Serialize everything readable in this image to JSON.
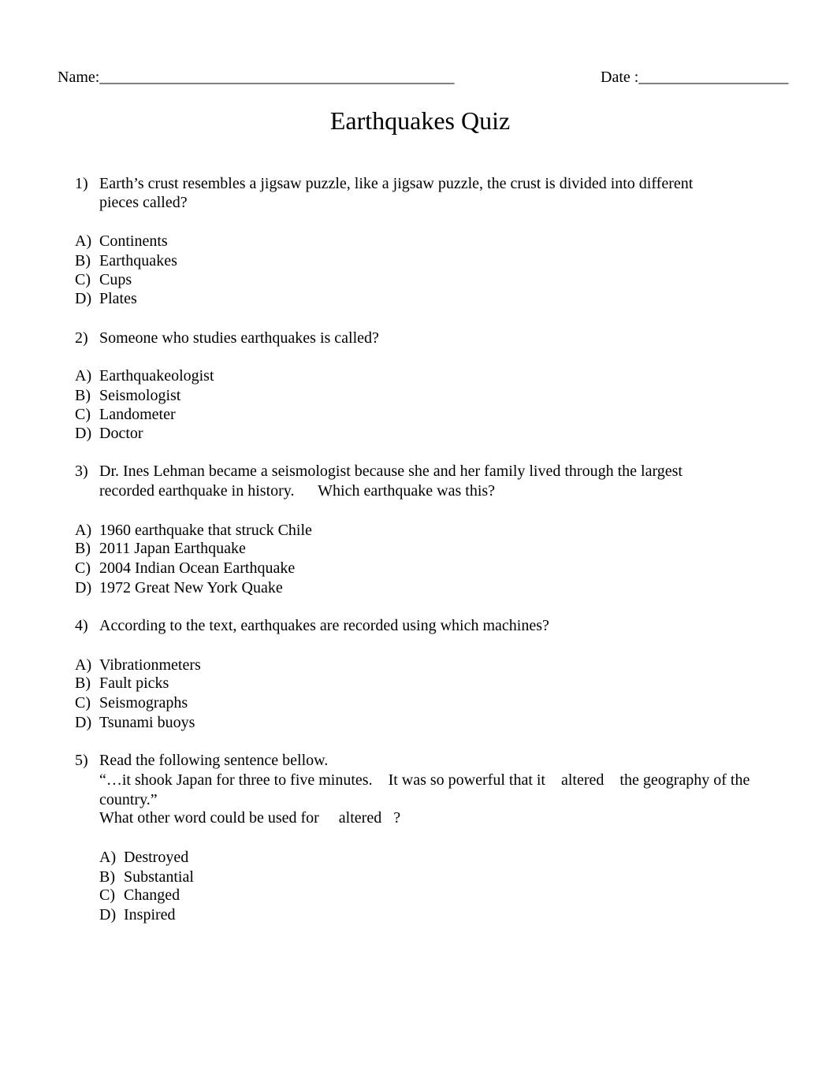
{
  "header": {
    "name_label": "Name:",
    "name_blank": "_____________________________________________",
    "date_label": "Date :",
    "date_blank": "___________________"
  },
  "title": "Earthquakes Quiz",
  "questions": [
    {
      "number": "1)",
      "lines": [
        "Earth’s crust resembles a jigsaw puzzle, like a jigsaw puzzle, the crust is divided into different",
        "pieces called?"
      ],
      "options": [
        {
          "label": "A)",
          "text": "Continents"
        },
        {
          "label": "B)",
          "text": "Earthquakes"
        },
        {
          "label": "C)",
          "text": "Cups"
        },
        {
          "label": "D)",
          "text": "Plates"
        }
      ]
    },
    {
      "number": "2)",
      "lines": [
        "Someone who studies earthquakes is called?"
      ],
      "options": [
        {
          "label": "A)",
          "text": "Earthquakeologist"
        },
        {
          "label": "B)",
          "text": "Seismologist"
        },
        {
          "label": "C)",
          "text": "Landometer"
        },
        {
          "label": "D)",
          "text": "Doctor"
        }
      ]
    },
    {
      "number": "3)",
      "lines": [
        "Dr. Ines Lehman became a seismologist because she and her family lived through the largest",
        "recorded earthquake in history.      Which earthquake was this?"
      ],
      "options": [
        {
          "label": "A)",
          "text": "1960 earthquake that struck Chile"
        },
        {
          "label": "B)",
          "text": "2011 Japan Earthquake"
        },
        {
          "label": "C)",
          "text": "2004 Indian Ocean Earthquake"
        },
        {
          "label": "D)",
          "text": "1972 Great New York Quake"
        }
      ]
    },
    {
      "number": "4)",
      "lines": [
        "According to the text, earthquakes are recorded using which machines?"
      ],
      "options": [
        {
          "label": "A)",
          "text": "Vibrationmeters"
        },
        {
          "label": "B)",
          "text": "Fault picks"
        },
        {
          "label": "C)",
          "text": "Seismographs"
        },
        {
          "label": "D)",
          "text": "Tsunami buoys"
        }
      ]
    },
    {
      "number": "5)",
      "lines": [
        "Read the following sentence bellow.",
        "“…it shook Japan for three to five minutes.    It was so powerful that it    altered    the geography of the",
        "country.”",
        "What other word could be used for     altered   ?"
      ],
      "options": [
        {
          "label": "A)",
          "text": "Destroyed"
        },
        {
          "label": "B)",
          "text": "Substantial"
        },
        {
          "label": "C)",
          "text": "Changed"
        },
        {
          "label": "D)",
          "text": "Inspired"
        }
      ]
    }
  ]
}
